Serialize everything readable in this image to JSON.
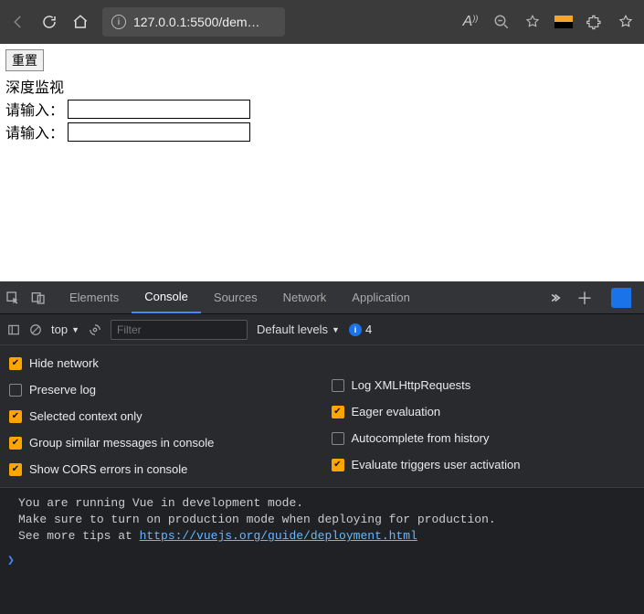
{
  "browser": {
    "url": "127.0.0.1:5500/dem…"
  },
  "page": {
    "reset_label": "重置",
    "heading": "深度监视",
    "input1_label": "请输入：",
    "input1_value": "",
    "input2_label": "请输入：",
    "input2_value": ""
  },
  "devtools": {
    "tabs": {
      "elements": "Elements",
      "console": "Console",
      "sources": "Sources",
      "network": "Network",
      "application": "Application"
    },
    "toolbar": {
      "top": "top",
      "filter_placeholder": "Filter",
      "levels_label": "Default levels",
      "info_count": "4"
    },
    "settings": {
      "hide_network": "Hide network",
      "preserve_log": "Preserve log",
      "selected_context_only": "Selected context only",
      "group_similar": "Group similar messages in console",
      "show_cors": "Show CORS errors in console",
      "log_xhr": "Log XMLHttpRequests",
      "eager_eval": "Eager evaluation",
      "autocomplete_history": "Autocomplete from history",
      "eval_triggers": "Evaluate triggers user activation"
    },
    "console_msg": {
      "line1": "You are running Vue in development mode.",
      "line2": "Make sure to turn on production mode when deploying for production.",
      "line3_prefix": "See more tips at ",
      "line3_link": "https://vuejs.org/guide/deployment.html"
    }
  }
}
